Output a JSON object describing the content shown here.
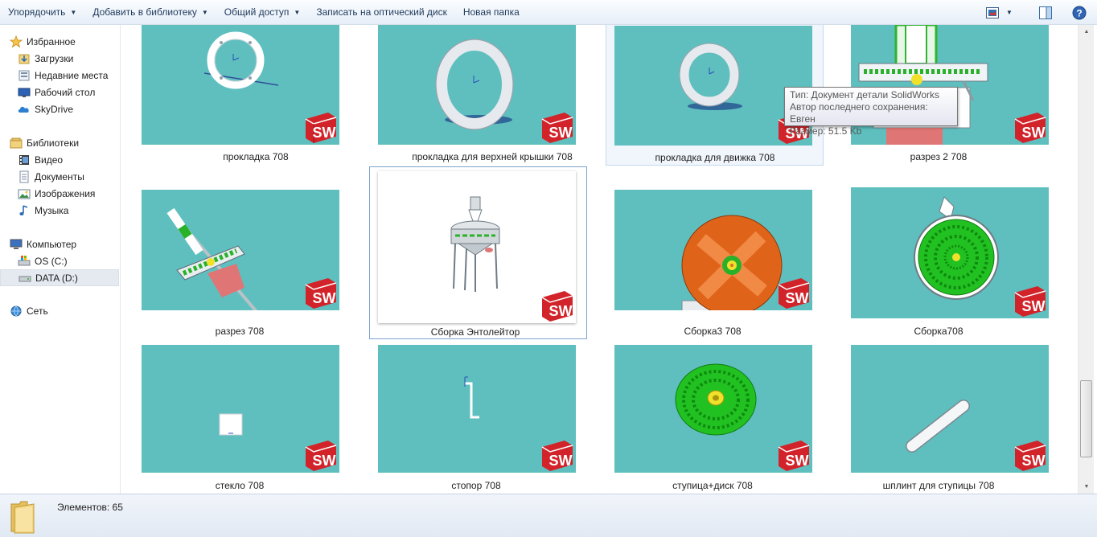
{
  "toolbar": {
    "organize_label": "Упорядочить",
    "add_to_library_label": "Добавить в библиотеку",
    "share_label": "Общий доступ",
    "burn_label": "Записать на оптический диск",
    "new_folder_label": "Новая папка",
    "view_icon": "change-view-icon",
    "preview_icon": "preview-pane-icon",
    "help_icon": "help-icon"
  },
  "sidebar": {
    "favorites": {
      "label": "Избранное",
      "items": [
        {
          "label": "Загрузки",
          "icon": "downloads-icon"
        },
        {
          "label": "Недавние места",
          "icon": "recent-places-icon"
        },
        {
          "label": "Рабочий стол",
          "icon": "desktop-icon"
        },
        {
          "label": "SkyDrive",
          "icon": "skydrive-icon"
        }
      ]
    },
    "libraries": {
      "label": "Библиотеки",
      "items": [
        {
          "label": "Видео",
          "icon": "video-icon"
        },
        {
          "label": "Документы",
          "icon": "documents-icon"
        },
        {
          "label": "Изображения",
          "icon": "pictures-icon"
        },
        {
          "label": "Музыка",
          "icon": "music-icon"
        }
      ]
    },
    "computer": {
      "label": "Компьютер",
      "items": [
        {
          "label": "OS (C:)",
          "icon": "drive-c-icon"
        },
        {
          "label": "DATA (D:)",
          "icon": "drive-d-icon",
          "selected": true
        }
      ]
    },
    "network": {
      "label": "Сеть"
    }
  },
  "files": [
    {
      "name": "прокладка 708"
    },
    {
      "name": "прокладка для верхней крышки 708"
    },
    {
      "name": "прокладка для движка 708",
      "hovered": true
    },
    {
      "name": "разрез 2 708"
    },
    {
      "name": "разрез 708"
    },
    {
      "name": "Сборка Энтолейтор",
      "selected": true
    },
    {
      "name": "Сборка3 708"
    },
    {
      "name": "Сборка708"
    },
    {
      "name": "стекло 708"
    },
    {
      "name": "стопор 708"
    },
    {
      "name": "ступица+диск 708"
    },
    {
      "name": "шплинт для ступицы 708"
    }
  ],
  "tooltip": {
    "type_line": "Тип: Документ детали SolidWorks",
    "author_line": "Автор последнего сохранения: Евген",
    "size_line": "Размер: 51.5 Kb"
  },
  "status": {
    "count_text": "Элементов: 65"
  },
  "colors": {
    "thumb_bg": "#5fbfbf",
    "sw_red": "#d2232a",
    "orange_disk": "#e0631a",
    "green_disk": "#22c122"
  }
}
